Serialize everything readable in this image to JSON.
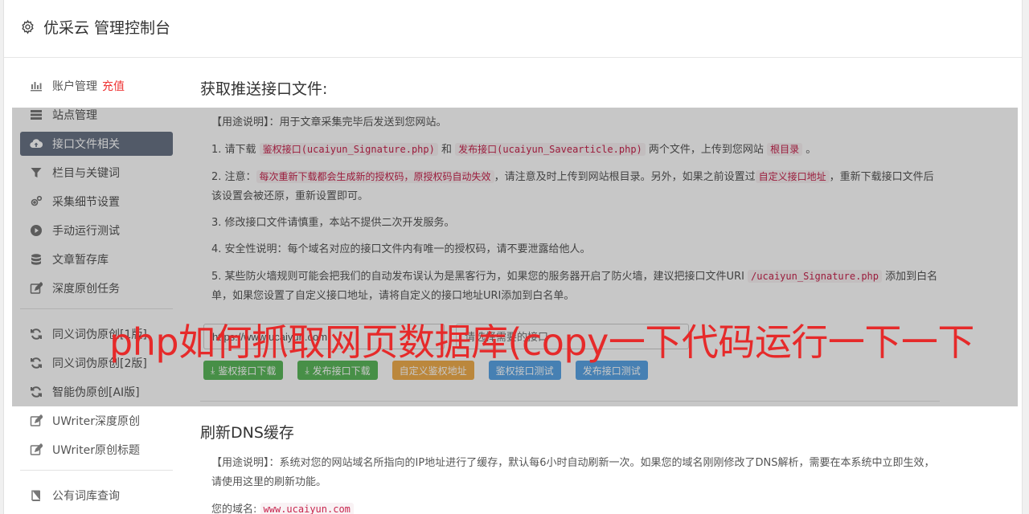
{
  "header": {
    "title": "优采云 管理控制台",
    "icon": "gear-icon"
  },
  "sidebar": {
    "items": [
      {
        "label": "账户管理",
        "icon": "bar-chart-icon",
        "badge": "充值"
      },
      {
        "label": "站点管理",
        "icon": "server-icon"
      },
      {
        "label": "接口文件相关",
        "icon": "cloud-upload-icon",
        "active": true
      },
      {
        "label": "栏目与关键词",
        "icon": "filter-icon"
      },
      {
        "label": "采集细节设置",
        "icon": "cogs-icon"
      },
      {
        "label": "手动运行测试",
        "icon": "play-circle-icon"
      },
      {
        "label": "文章暂存库",
        "icon": "database-icon"
      },
      {
        "label": "深度原创任务",
        "icon": "edit-icon"
      }
    ],
    "items2": [
      {
        "label": "同义词伪原创[1版]",
        "icon": "refresh-icon"
      },
      {
        "label": "同义词伪原创[2版]",
        "icon": "refresh-icon"
      },
      {
        "label": "智能伪原创[AI版]",
        "icon": "refresh-icon"
      },
      {
        "label": "UWriter深度原创",
        "icon": "edit-icon"
      },
      {
        "label": "UWriter原创标题",
        "icon": "edit-icon"
      }
    ],
    "items3": [
      {
        "label": "公有词库查询",
        "icon": "book-icon"
      }
    ]
  },
  "section1": {
    "title": "获取推送接口文件:",
    "usage_prefix": "【用途说明】：",
    "usage_text": "用于文章采集完毕后发送到您网站。",
    "p1_a": "1. 请下载",
    "p1_code1": "鉴权接口(ucaiyun_Signature.php)",
    "p1_b": "和",
    "p1_code2": "发布接口(ucaiyun_Savearticle.php)",
    "p1_c": "两个文件，上传到您网站",
    "p1_code3": "根目录",
    "p1_d": "。",
    "p2_a": "2. 注意：",
    "p2_code1": "每次重新下载都会生成新的授权码，原授权码自动失效",
    "p2_b": "，请注意及时上传到网站根目录。另外，如果之前设置过",
    "p2_code2": "自定义接口地址",
    "p2_c": "，重新下载接口文件后该设置会被还原，重新设置即可。",
    "p3": "3. 修改接口文件请慎重，本站不提供二次开发服务。",
    "p4": "4. 安全性说明：每个域名对应的接口文件内有唯一的授权码，请不要泄露给他人。",
    "p5_a": "5. 某些防火墙规则可能会把我们的自动发布误认为是黑客行为，如果您的服务器开启了防火墙，建议把接口文件URI",
    "p5_code": "/ucaiyun_Signature.php",
    "p5_b": "添加到白名单，如果您设置了自定义接口地址，请将自定义的接口地址URI添加到白名单。",
    "input1_value": "https://www.ucaiyun.com",
    "input2_placeholder": "请选择需要的接口",
    "btn_sig_download": "鉴权接口下载",
    "btn_pub_download": "发布接口下载",
    "btn_custom": "自定义鉴权地址",
    "btn_sig_test": "鉴权接口测试",
    "btn_pub_test": "发布接口测试"
  },
  "section2": {
    "title": "刷新DNS缓存",
    "usage_prefix": "【用途说明】：",
    "usage_text": "系统对您的网站域名所指向的IP地址进行了缓存，默认每6小时自动刷新一次。如果您的域名刚刚修改了DNS解析，需要在本系统中立即生效，请使用这里的刷新功能。",
    "domain_label": "您的域名:",
    "domain_value": "www.ucaiyun.com"
  },
  "watermark": "php如何抓取网页数据库(copy一下代码运行一下一下"
}
